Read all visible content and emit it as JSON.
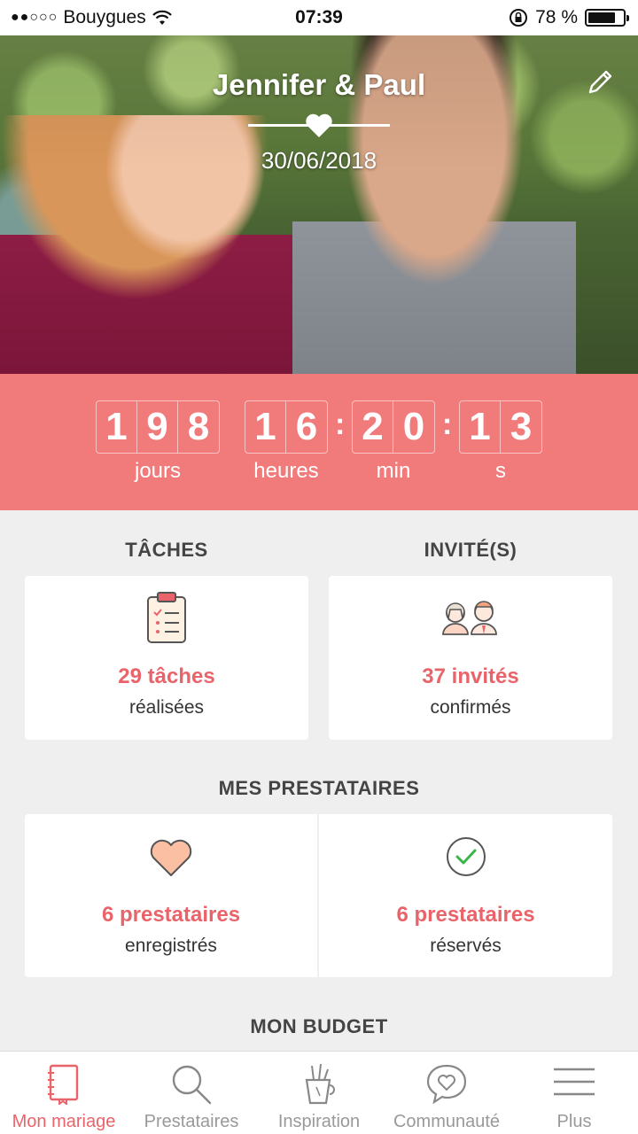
{
  "status_bar": {
    "signal_dots": "●●○○○",
    "carrier": "Bouygues",
    "time": "07:39",
    "battery_percent": "78 %",
    "battery_level": 0.78
  },
  "hero": {
    "couple_names": "Jennifer & Paul",
    "wedding_date": "30/06/2018",
    "icons": {
      "edit": "pencil-icon",
      "divider": "heart-icon"
    }
  },
  "countdown": {
    "days": [
      "1",
      "9",
      "8"
    ],
    "hours": [
      "1",
      "6"
    ],
    "minutes": [
      "2",
      "0"
    ],
    "seconds": [
      "1",
      "3"
    ],
    "days_label": "jours",
    "hours_label": "heures",
    "minutes_label": "min",
    "seconds_label": "s",
    "colon": ":",
    "background_color": "#f17a7a"
  },
  "tasks": {
    "title": "TÂCHES",
    "value": "29 tâches",
    "sub": "réalisées",
    "icon": "clipboard-checklist-icon"
  },
  "guests": {
    "title": "INVITÉ(S)",
    "value": "37 invités",
    "sub": "confirmés",
    "icon": "couple-avatars-icon"
  },
  "vendors": {
    "title": "MES PRESTATAIRES",
    "saved": {
      "value": "6 prestataires",
      "sub": "enregistrés",
      "icon": "heart-icon"
    },
    "booked": {
      "value": "6 prestataires",
      "sub": "réservés",
      "icon": "check-circle-icon"
    }
  },
  "budget": {
    "title": "MON BUDGET"
  },
  "tab_bar": {
    "items": [
      {
        "label": "Mon mariage",
        "icon": "notebook-icon",
        "active": true
      },
      {
        "label": "Prestataires",
        "icon": "search-icon",
        "active": false
      },
      {
        "label": "Inspiration",
        "icon": "pencil-cup-icon",
        "active": false
      },
      {
        "label": "Communauté",
        "icon": "chat-heart-icon",
        "active": false
      },
      {
        "label": "Plus",
        "icon": "menu-icon",
        "active": false
      }
    ]
  },
  "colors": {
    "accent": "#e9646a",
    "countdown": "#f17a7a",
    "background": "#efefef"
  }
}
